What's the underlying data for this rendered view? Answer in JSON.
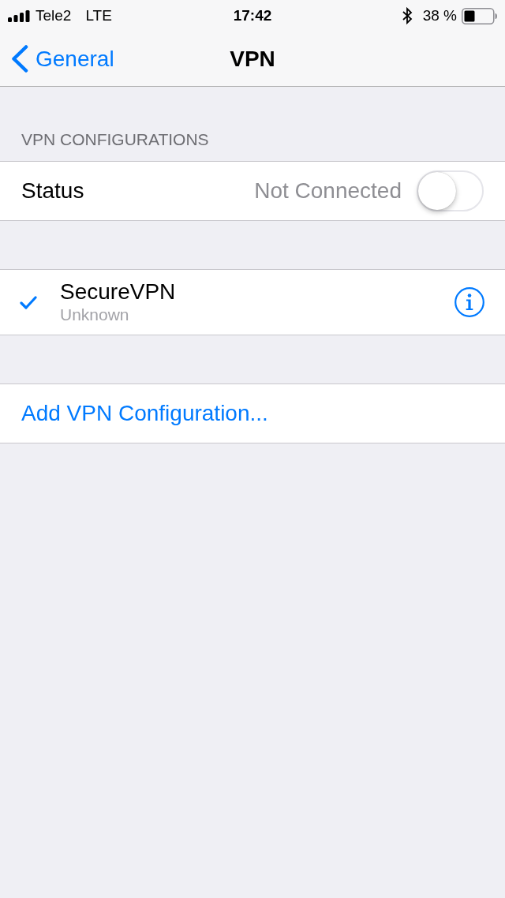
{
  "status_bar": {
    "carrier": "Tele2",
    "network": "LTE",
    "time": "17:42",
    "battery_text": "38 %"
  },
  "nav_bar": {
    "back_label": "General",
    "title": "VPN"
  },
  "vpn": {
    "header": "VPN CONFIGURATIONS",
    "status": {
      "label": "Status",
      "value": "Not Connected",
      "on": false
    }
  },
  "configurations": [
    {
      "name": "SecureVPN",
      "detail": "Unknown",
      "selected": true
    }
  ],
  "add_configuration": {
    "label": "Add VPN Configuration..."
  }
}
